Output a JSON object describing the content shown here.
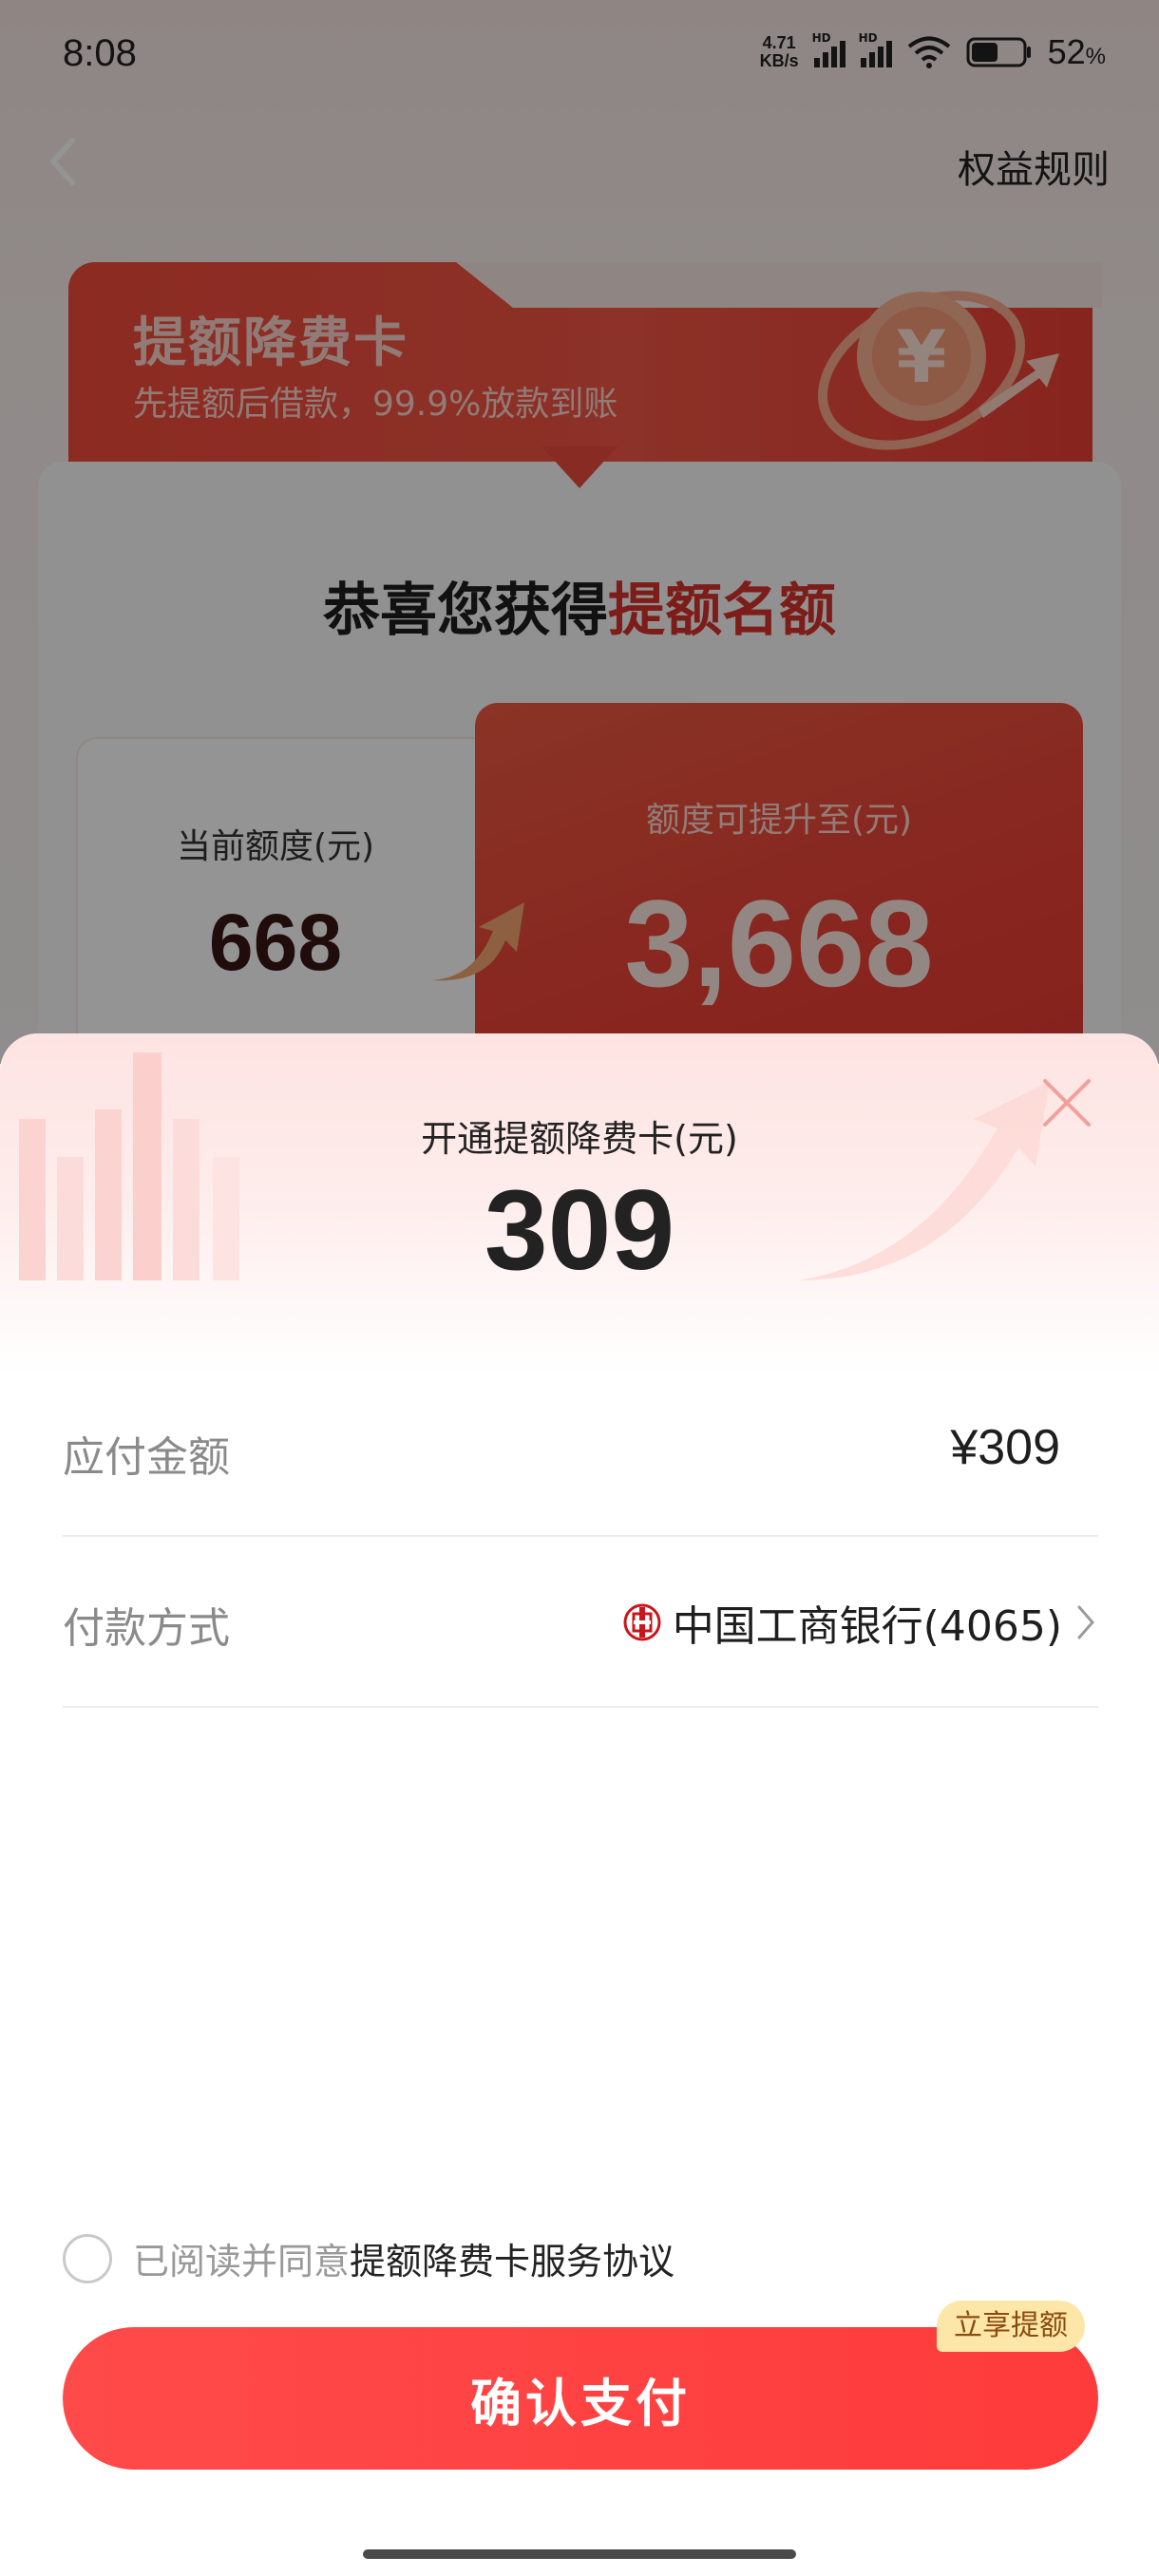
{
  "status_bar": {
    "time": "8:08",
    "net_speed_value": "4.71",
    "net_speed_unit": "KB/s",
    "signal_1_label": "HD",
    "signal_2_label": "HD",
    "battery_level": 0.52,
    "battery_percent": "52",
    "battery_unit": "%"
  },
  "header": {
    "back_icon": "chevron-left-icon",
    "rules_label": "权益规则"
  },
  "hero": {
    "title": "提额降费卡",
    "subtitle": "先提额后借款，99.9%放款到账",
    "icon": "yuan-coin-icon"
  },
  "card": {
    "congrats_prefix": "恭喜您获得",
    "congrats_highlight": "提额名额",
    "current_label": "当前额度(元)",
    "current_value": "668",
    "upgrade_label": "额度可提升至(元)",
    "upgrade_value": "3,668"
  },
  "sheet": {
    "title": "开通提额降费卡(元)",
    "amount": "309",
    "payable_label": "应付金额",
    "payable_value": "¥309",
    "payment_label": "付款方式",
    "payment_value": "中国工商银行(4065)",
    "bank_icon": "icbc-logo-icon",
    "agree_text": "已阅读并同意",
    "agree_link": "提额降费卡服务协议",
    "confirm_label": "确认支付",
    "promo_badge": "立享提额"
  },
  "colors": {
    "accent": "#fe3b3b",
    "highlight": "#d8322c",
    "badge_bg": "#fde7a8"
  }
}
